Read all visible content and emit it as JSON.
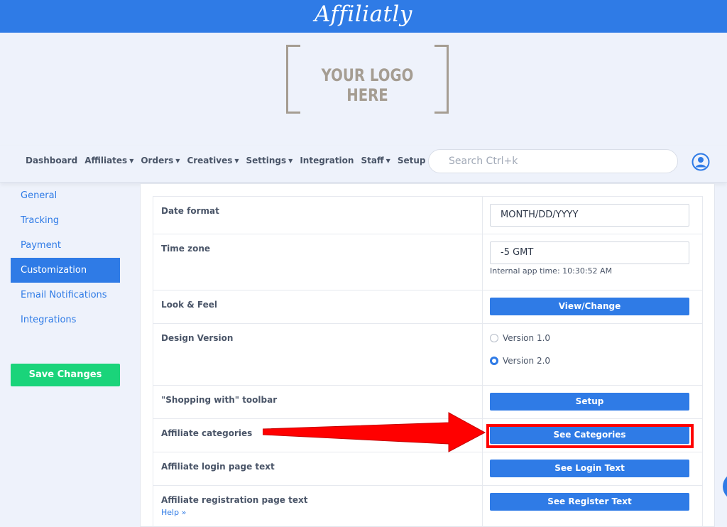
{
  "brand": "Affiliatly",
  "logo_placeholder": "YOUR LOGO HERE",
  "nav": {
    "items": [
      {
        "label": "Dashboard",
        "caret": false
      },
      {
        "label": "Affiliates",
        "caret": true
      },
      {
        "label": "Orders",
        "caret": true
      },
      {
        "label": "Creatives",
        "caret": true
      },
      {
        "label": "Settings",
        "caret": true
      },
      {
        "label": "Integration",
        "caret": false
      },
      {
        "label": "Staff",
        "caret": true
      },
      {
        "label": "Setup",
        "caret": false
      }
    ],
    "search_placeholder": "Search Ctrl+k",
    "avatar_icon": "user-circle-icon"
  },
  "sidebar": {
    "items": [
      {
        "label": "General",
        "active": false
      },
      {
        "label": "Tracking",
        "active": false
      },
      {
        "label": "Payment",
        "active": false
      },
      {
        "label": "Customization",
        "active": true
      },
      {
        "label": "Email Notifications",
        "active": false
      },
      {
        "label": "Integrations",
        "active": false
      }
    ],
    "save_label": "Save Changes"
  },
  "settings": {
    "date_format": {
      "label": "Date format",
      "value": "MONTH/DD/YYYY"
    },
    "time_zone": {
      "label": "Time zone",
      "value": "-5 GMT",
      "hint_label": "Internal app time:",
      "hint_value": "10:30:52 AM"
    },
    "look_feel": {
      "label": "Look & Feel",
      "button": "View/Change"
    },
    "design_version": {
      "label": "Design Version",
      "options": [
        {
          "label": "Version 1.0",
          "selected": false
        },
        {
          "label": "Version 2.0",
          "selected": true
        }
      ]
    },
    "shopping_toolbar": {
      "label": "\"Shopping with\" toolbar",
      "button": "Setup"
    },
    "affiliate_categories": {
      "label": "Affiliate categories",
      "button": "See Categories"
    },
    "login_text": {
      "label": "Affiliate login page text",
      "button": "See Login Text"
    },
    "register_text": {
      "label": "Affiliate registration page text",
      "help": "Help",
      "button": "See Register Text"
    }
  },
  "colors": {
    "primary": "#2f7be6",
    "save": "#1ad47a",
    "annotation": "#ff0000"
  }
}
